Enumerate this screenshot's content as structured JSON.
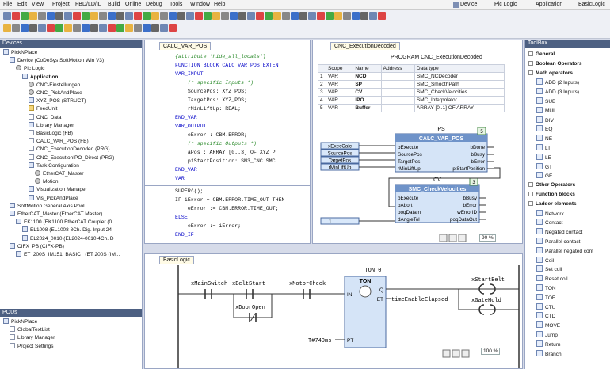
{
  "menu": [
    "File",
    "Edit",
    "View",
    "Project",
    "FBD/LD/IL",
    "Build",
    "Online",
    "Debug",
    "Tools",
    "Window",
    "Help"
  ],
  "breadcrumb": {
    "device": "Device",
    "plc_logic": "Plc Logic",
    "application": "Application",
    "basic_logic": "BasicLogic"
  },
  "devices_panel": {
    "title": "Devices",
    "items": [
      {
        "label": "PickNPlace",
        "indent": 0,
        "icon": "project-icon"
      },
      {
        "label": "Device (CoDeSys SoftMotion Win V3)",
        "indent": 1,
        "icon": "device-icon"
      },
      {
        "label": "Plc Logic",
        "indent": 2,
        "icon": "gear-icon"
      },
      {
        "label": "Application",
        "indent": 3,
        "icon": "application-icon",
        "bold": true
      },
      {
        "label": "CNC-Einstellungen",
        "indent": 4,
        "icon": "gear-icon"
      },
      {
        "label": "CNC_PickAndPlace",
        "indent": 4,
        "icon": "gear-icon"
      },
      {
        "label": "XYZ_POS (STRUCT)",
        "indent": 4,
        "icon": "struct-icon"
      },
      {
        "label": "FeedUnit",
        "indent": 4,
        "icon": "folder-icon"
      },
      {
        "label": "CNC_Data",
        "indent": 4,
        "icon": "doc-icon"
      },
      {
        "label": "Library Manager",
        "indent": 4,
        "icon": "library-icon"
      },
      {
        "label": "BasicLogic (FB)",
        "indent": 4,
        "icon": "doc-icon"
      },
      {
        "label": "CALC_VAR_POS (FB)",
        "indent": 4,
        "icon": "doc-icon"
      },
      {
        "label": "CNC_ExecutionDecoded (PRG)",
        "indent": 4,
        "icon": "doc-icon"
      },
      {
        "label": "CNC_ExecutionIPO_Direct (PRG)",
        "indent": 4,
        "icon": "doc-icon"
      },
      {
        "label": "Task Configuration",
        "indent": 4,
        "icon": "task-icon"
      },
      {
        "label": "EtherCAT_Master",
        "indent": 5,
        "icon": "gear-icon"
      },
      {
        "label": "Motion",
        "indent": 5,
        "icon": "gear-icon"
      },
      {
        "label": "Visualization Manager",
        "indent": 4,
        "icon": "visu-icon"
      },
      {
        "label": "Vis_PickAndPlace",
        "indent": 4,
        "icon": "visu-icon"
      },
      {
        "label": "SoftMotion General Axis Pool",
        "indent": 1,
        "icon": "axis-icon"
      },
      {
        "label": "EtherCAT_Master (EtherCAT Master)",
        "indent": 1,
        "icon": "ethercat-icon"
      },
      {
        "label": "EK1100 (EK1100 EtherCAT Coupler (0...",
        "indent": 2,
        "icon": "coupler-icon"
      },
      {
        "label": "EL1008 (EL1008 8Ch. Dig. Input 24",
        "indent": 3,
        "icon": "io-icon"
      },
      {
        "label": "EL2024_0010 (EL2024-0010 4Ch. D",
        "indent": 3,
        "icon": "io-icon"
      },
      {
        "label": "CIFX_PB (CIFX-PB)",
        "indent": 1,
        "icon": "cifx-icon"
      },
      {
        "label": "ET_200S_IM151_BASIC_ (ET 200S (IM...",
        "indent": 2,
        "icon": "io-icon"
      }
    ]
  },
  "pous_panel": {
    "title": "POUs",
    "items": [
      {
        "label": "PickNPlace",
        "indent": 0
      },
      {
        "label": "GlobalTextList",
        "indent": 1
      },
      {
        "label": "Library Manager",
        "indent": 1
      },
      {
        "label": "Project Settings",
        "indent": 1
      }
    ]
  },
  "editor_calc": {
    "tab": "CALC_VAR_POS",
    "decl_lines": [
      {
        "t": "{attribute 'hide_all_locals'}",
        "c": "cm"
      },
      {
        "t": "FUNCTION_BLOCK CALC_VAR_POS EXTEN",
        "c": "kw"
      },
      {
        "t": "VAR_INPUT",
        "c": "kw"
      },
      {
        "t": "    (* specific Inputs *)",
        "c": "cm"
      },
      {
        "t": "    SourcePos: XYZ_POS;",
        "c": ""
      },
      {
        "t": "    TargetPos: XYZ_POS;",
        "c": ""
      },
      {
        "t": "    rMinLiftUp: REAL;",
        "c": ""
      },
      {
        "t": "END_VAR",
        "c": "kw"
      },
      {
        "t": "VAR_OUTPUT",
        "c": "kw"
      },
      {
        "t": "    eError : CBM.ERROR;",
        "c": ""
      },
      {
        "t": "    (* specific Outputs *)",
        "c": "cm"
      },
      {
        "t": "    aPos : ARRAY [0..3] OF XYZ_P",
        "c": ""
      },
      {
        "t": "    piStartPosition: SM3_CNC.SMC",
        "c": ""
      },
      {
        "t": "END_VAR",
        "c": "kw"
      },
      {
        "t": "VAR",
        "c": "kw"
      }
    ],
    "impl_lines": [
      {
        "t": "SUPER^();",
        "c": ""
      },
      {
        "t": "IF iError = CBM.ERROR.TIME_OUT THEN",
        "c": ""
      },
      {
        "t": "    eError := CBM.ERROR.TIME_OUT;",
        "c": ""
      },
      {
        "t": "ELSE",
        "c": "kw"
      },
      {
        "t": "    eError := iError;",
        "c": ""
      },
      {
        "t": "END_IF",
        "c": "kw"
      }
    ]
  },
  "editor_cnc": {
    "tab": "CNC_ExecutionDecoded",
    "program_title": "PROGRAM CNC_ExecutionDecoded",
    "columns": [
      "Scope",
      "Name",
      "Address",
      "Data type"
    ],
    "rows": [
      {
        "no": "1",
        "scope": "VAR",
        "name": "NCD",
        "addr": "",
        "type": "SMC_NCDecoder"
      },
      {
        "no": "2",
        "scope": "VAR",
        "name": "SP",
        "addr": "",
        "type": "SMC_SmoothPath"
      },
      {
        "no": "3",
        "scope": "VAR",
        "name": "CV",
        "addr": "",
        "type": "SMC_CheckVelocities"
      },
      {
        "no": "4",
        "scope": "VAR",
        "name": "IPO",
        "addr": "",
        "type": "SMC_Interpolator"
      },
      {
        "no": "5",
        "scope": "VAR",
        "name": "Buffer",
        "addr": "",
        "type": "ARRAY [0..1] OF ARRAY"
      }
    ],
    "fb1": {
      "instance": "PS",
      "type": "CALC_VAR_POS",
      "no": "5",
      "inputs": [
        "bExecute",
        "SourcePos",
        "TargetPos",
        "rMinLiftUp"
      ],
      "outputs": [
        "bDone",
        "bBusy",
        "bError",
        "piStartPosition"
      ]
    },
    "fb1_vars": [
      "xExecCalc",
      "SourcePos",
      "TargetPos",
      "rMinLiftUp"
    ],
    "fb2": {
      "instance": "CV",
      "type": "SMC_CheckVelocities",
      "no": "3",
      "inputs": [
        "bExecute",
        "bAbort",
        "poqDataIn",
        "dAngleTol"
      ],
      "outputs": [
        "bBusy",
        "bError",
        "wErrorID",
        "poqDataOut"
      ]
    },
    "fb2_const": "1",
    "zoom": "90 %"
  },
  "editor_basic": {
    "tab": "BasicLogic",
    "contacts": [
      "xMainSwitch",
      "xBeltStart",
      "xMotorCheck",
      "xDoorOpen"
    ],
    "timer": {
      "instance": "TON_0",
      "type": "TON",
      "in": "IN",
      "q": "Q",
      "et": "ET",
      "pt": "PT",
      "pt_value": "T#740ms"
    },
    "q_var": "timeEnableElapsed",
    "coils": [
      "xStartBelt",
      "xGateHold"
    ],
    "zoom": "100 %"
  },
  "toolbox": {
    "title": "ToolBox",
    "items": [
      {
        "label": "General",
        "kind": "group"
      },
      {
        "label": "Boolean Operators",
        "kind": "group"
      },
      {
        "label": "Math operators",
        "kind": "group"
      },
      {
        "label": "ADD (2 Inputs)",
        "kind": "item"
      },
      {
        "label": "ADD (3 Inputs)",
        "kind": "item"
      },
      {
        "label": "SUB",
        "kind": "item"
      },
      {
        "label": "MUL",
        "kind": "item"
      },
      {
        "label": "DIV",
        "kind": "item"
      },
      {
        "label": "EQ",
        "kind": "item"
      },
      {
        "label": "NE",
        "kind": "item"
      },
      {
        "label": "LT",
        "kind": "item"
      },
      {
        "label": "LE",
        "kind": "item"
      },
      {
        "label": "GT",
        "kind": "item"
      },
      {
        "label": "GE",
        "kind": "item"
      },
      {
        "label": "Other Operators",
        "kind": "group"
      },
      {
        "label": "Function blocks",
        "kind": "group"
      },
      {
        "label": "Ladder elements",
        "kind": "group"
      },
      {
        "label": "Network",
        "kind": "item"
      },
      {
        "label": "Contact",
        "kind": "item"
      },
      {
        "label": "Negated contact",
        "kind": "item"
      },
      {
        "label": "Parallel contact",
        "kind": "item"
      },
      {
        "label": "Parallel negated cont",
        "kind": "item"
      },
      {
        "label": "Coil",
        "kind": "item"
      },
      {
        "label": "Set coil",
        "kind": "item"
      },
      {
        "label": "Reset coil",
        "kind": "item"
      },
      {
        "label": "TON",
        "kind": "item"
      },
      {
        "label": "TOF",
        "kind": "item"
      },
      {
        "label": "CTU",
        "kind": "item"
      },
      {
        "label": "CTD",
        "kind": "item"
      },
      {
        "label": "MOVE",
        "kind": "item"
      },
      {
        "label": "Jump",
        "kind": "item"
      },
      {
        "label": "Return",
        "kind": "item"
      },
      {
        "label": "Branch",
        "kind": "item"
      }
    ]
  },
  "colors": {
    "panel_header": "#4d6082",
    "fb_header": "#6f93c9",
    "fb_body": "#d5e4f7",
    "keyword": "#0000c8",
    "comment": "#2a8a2a"
  }
}
